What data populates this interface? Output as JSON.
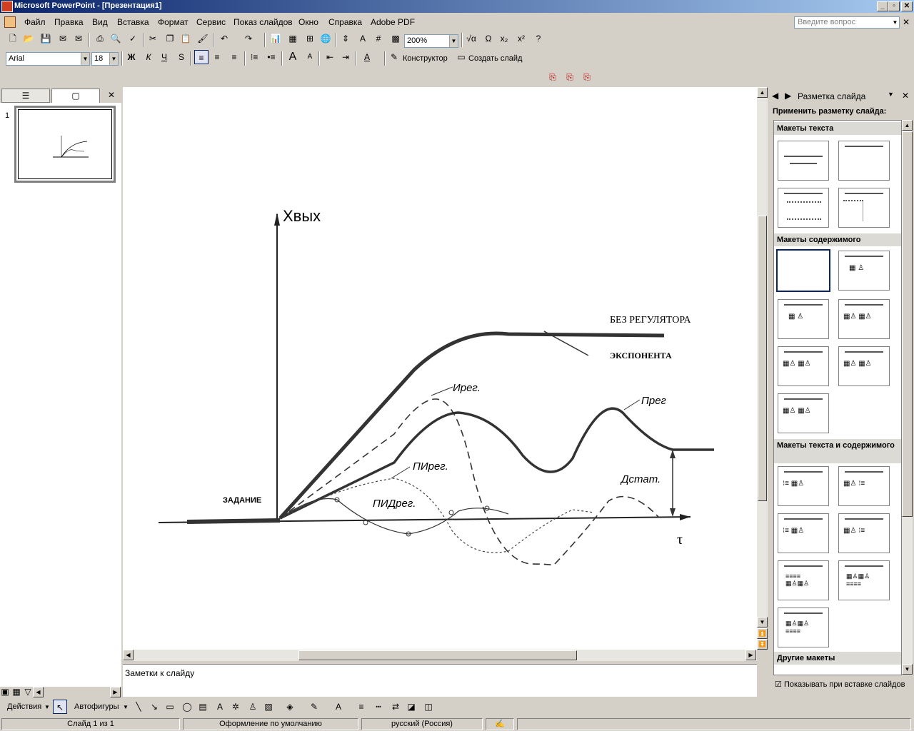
{
  "window": {
    "title": "Microsoft PowerPoint - [Презентация1]",
    "min_label": "_",
    "max_label": "▫",
    "close_label": "✕"
  },
  "menu": {
    "items": [
      "Файл",
      "Правка",
      "Вид",
      "Вставка",
      "Формат",
      "Сервис",
      "Показ слайдов",
      "Окно",
      "Справка",
      "Adobe PDF"
    ],
    "ask_placeholder": "Введите вопрос"
  },
  "toolbar": {
    "zoom": "200%",
    "font": "Arial",
    "font_size": "18",
    "bold": "Ж",
    "italic": "К",
    "underline": "Ч",
    "shadow": "S",
    "designer": "Конструктор",
    "new_slide": "Создать слайд"
  },
  "left_pane": {
    "slide_number": "1"
  },
  "slide": {
    "y_axis": "Xвых",
    "x_axis": "τ",
    "setpoint": "ЗАДАНИЕ",
    "no_regulator": "БЕЗ РЕГУЛЯТОРА",
    "exponent": "ЭКСПОНЕНТА",
    "i_reg": "Ирег.",
    "p_reg": "Прег",
    "pi_reg": "ПИрег.",
    "pid_reg": "ПИДрег.",
    "static_error": "Дстат."
  },
  "notes": {
    "placeholder": "Заметки к слайду"
  },
  "taskpane": {
    "title": "Разметка слайда",
    "apply": "Применить разметку слайда:",
    "sections": {
      "text": "Макеты текста",
      "content": "Макеты содержимого",
      "text_content": "Макеты текста и содержимого",
      "other": "Другие макеты"
    },
    "show_on_insert": "Показывать при вставке слайдов"
  },
  "drawing": {
    "actions": "Действия",
    "autoshapes": "Автофигуры"
  },
  "status": {
    "slide": "Слайд 1 из 1",
    "design": "Оформление по умолчанию",
    "language": "русский (Россия)"
  }
}
